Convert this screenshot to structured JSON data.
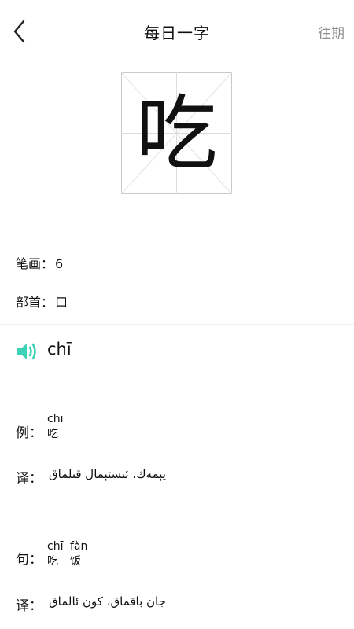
{
  "header": {
    "title": "每日一字",
    "past_label": "往期"
  },
  "character": {
    "glyph": "吃",
    "strokes_label": "笔画：",
    "strokes_value": "6",
    "radical_label": "部首：",
    "radical_value": "口",
    "pinyin": "chī"
  },
  "examples": [
    {
      "label": "例：",
      "pinyin": "chī",
      "hanzi": "吃",
      "translation_label": "译：",
      "translation": "يېمەك، ئىستېمال قىلماق"
    },
    {
      "label": "句：",
      "pinyin_1": "chī",
      "hanzi_1": "吃",
      "pinyin_2": "fàn",
      "hanzi_2": "饭",
      "translation_label": "译：",
      "translation": "جان باقماق، كۈن ئالماق"
    }
  ],
  "colors": {
    "accent": "#3dd3b6",
    "muted": "#8d8d8d",
    "divider": "#efefef"
  }
}
